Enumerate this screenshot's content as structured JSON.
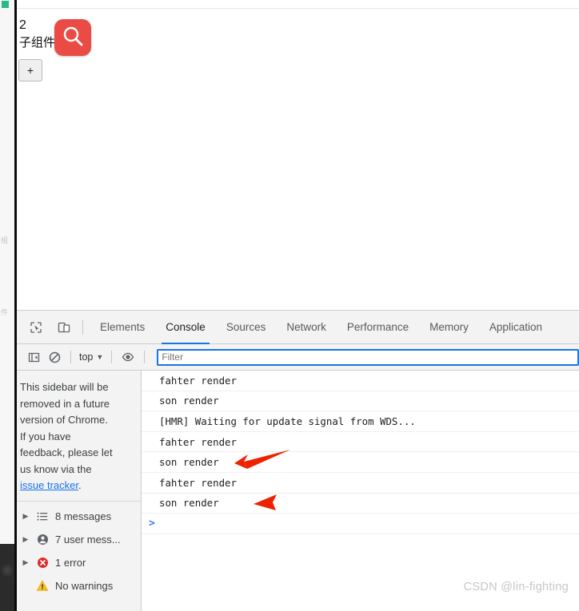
{
  "page": {
    "count": "2",
    "label": "子组件",
    "add_button": "+",
    "cursor_icon": "search-icon",
    "cursor_icon_color": "#ea4c45"
  },
  "sidebar_strip": {
    "marks": [
      "组",
      "件"
    ]
  },
  "devtools": {
    "toolbar_icons": [
      {
        "name": "inspect-element-icon",
        "label": "Inspect element"
      },
      {
        "name": "device-toolbar-icon",
        "label": "Toggle device toolbar"
      }
    ],
    "tabs": [
      {
        "label": "Elements",
        "active": false
      },
      {
        "label": "Console",
        "active": true
      },
      {
        "label": "Sources",
        "active": false
      },
      {
        "label": "Network",
        "active": false
      },
      {
        "label": "Performance",
        "active": false
      },
      {
        "label": "Memory",
        "active": false
      },
      {
        "label": "Application",
        "active": false
      }
    ],
    "active_tab_underline_color": "#1a73e8",
    "console_toolbar": {
      "sidebar_toggle_icon": "console-sidebar-toggle-icon",
      "clear_console_icon": "clear-console-icon",
      "context_selector": "top",
      "context_caret": "▼",
      "live_expression_icon": "eye-icon",
      "filter_value": "",
      "filter_placeholder": "Filter"
    },
    "console_sidebar": {
      "notice_line1": "This sidebar will be",
      "notice_line2": "removed in a future",
      "notice_line3": "version of Chrome.",
      "notice_line4": "If you have",
      "notice_line5": "feedback, please let",
      "notice_line6": "us know via the",
      "notice_link": "issue tracker",
      "notice_period": ".",
      "items": [
        {
          "arrow": "▶",
          "icon": "list-icon",
          "label": "8 messages"
        },
        {
          "arrow": "▶",
          "icon": "user-icon",
          "label": "7 user mess..."
        },
        {
          "arrow": "▶",
          "icon": "error-icon",
          "label": "1 error"
        },
        {
          "arrow": "",
          "icon": "warning-icon",
          "label": "No warnings"
        }
      ]
    },
    "console_logs": [
      {
        "text": "fahter render"
      },
      {
        "text": "son render"
      },
      {
        "text": "[HMR] Waiting for update signal from WDS..."
      },
      {
        "text": "fahter render"
      },
      {
        "text": "son render"
      },
      {
        "text": "fahter render"
      },
      {
        "text": "son render"
      }
    ],
    "prompt_caret": ">"
  },
  "annotations": {
    "arrow_color": "#ee2200",
    "arrow_count": 2
  },
  "watermark": "CSDN @lin-fighting"
}
